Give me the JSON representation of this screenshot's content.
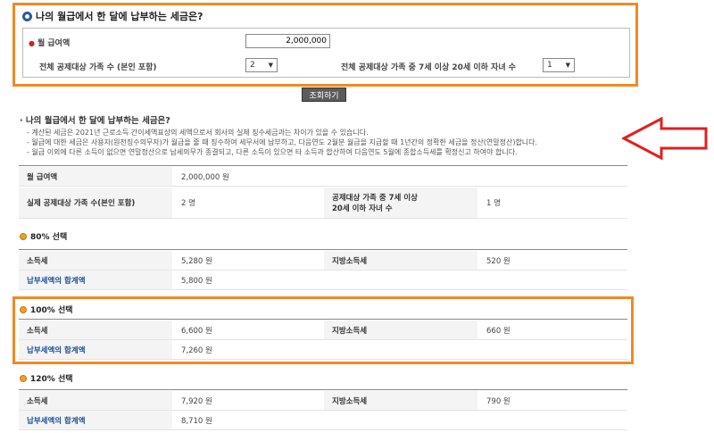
{
  "form": {
    "title": "나의 월급에서 한 달에 납부하는 세금은?",
    "salary_label": "월 급여액",
    "salary_value": "2,000,000",
    "family_label": "전체 공제대상 가족 수 (본인 포함)",
    "family_value": "2",
    "children_label": "전체 공제대상 가족 중 7세 이상 20세 이하 자녀 수",
    "children_value": "1",
    "required_mark": "●"
  },
  "query_button": "조회하기",
  "notes": {
    "title": "· 나의 월급에서 한 달에 납부하는 세금은?",
    "items": [
      "- 계산된 세금은   2021년  근로소득 간이세액표상의 세액으로서 회사의 실제 징수세금과는 차이가 있을 수 있습니다.",
      "- 월급에 대한 세금은 사용자(원천징수의무자)가 월급을 줄 때 징수하여 세무서에 납부하고, 다음연도 2월분 월급을 지급할 때 1년간의 정확한 세금을 정산(연말정산)합니다.",
      "- 월급 이외에 다른 소득이 없으면 연말정산으로 납세의무가 종결되고, 다른 소득이 있으면 타 소득과 합산하여 다음연도 5월에 종합소득세를 확정신고 하여야 합니다."
    ]
  },
  "summary": {
    "salary_label": "월 급여액",
    "salary_value": "2,000,000  원",
    "family_label": "실제 공제대상 가족 수(본인 포함)",
    "family_value": "2  명",
    "children_label_1": "공제대상 가족 중 7세 이상",
    "children_label_2": "20세 이하 자녀 수",
    "children_value": "1  명"
  },
  "sections": [
    {
      "title": "80% 선택",
      "income_label": "소득세",
      "income_value": "5,280  원",
      "local_label": "지방소득세",
      "local_value": "520  원",
      "total_label": "납부세액의 합계액",
      "total_value": "5,800  원"
    },
    {
      "title": "100% 선택",
      "income_label": "소득세",
      "income_value": "6,600  원",
      "local_label": "지방소득세",
      "local_value": "660  원",
      "total_label": "납부세액의 합계액",
      "total_value": "7,260  원"
    },
    {
      "title": "120% 선택",
      "income_label": "소득세",
      "income_value": "7,920  원",
      "local_label": "지방소득세",
      "local_value": "790  원",
      "total_label": "납부세액의 합계액",
      "total_value": "8,710  원"
    }
  ],
  "colors": {
    "highlight": "#f08a24",
    "arrow": "#e02020",
    "link_blue": "#1f4e9a",
    "button": "#5b5b5b"
  }
}
